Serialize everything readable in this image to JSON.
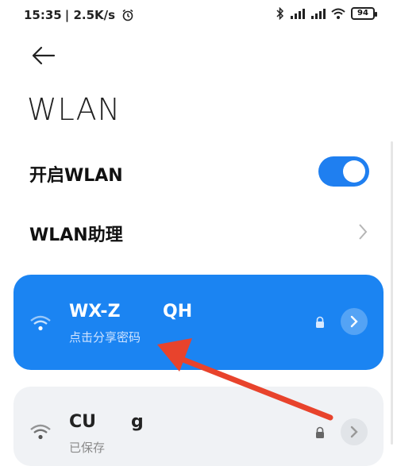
{
  "status": {
    "time": "15:35",
    "speed": "| 2.5K/s",
    "battery": "94"
  },
  "page": {
    "title": "WLAN"
  },
  "settings": {
    "enable_label": "开启WLAN",
    "enable_on": true,
    "assistant_label": "WLAN助理"
  },
  "networks": [
    {
      "name_left": "WX-Z",
      "name_right": "QH",
      "subtitle": "点击分享密码",
      "connected": true
    },
    {
      "name_left": "CU",
      "name_right": "g",
      "subtitle": "已保存",
      "connected": false
    }
  ],
  "colors": {
    "accent": "#1f7ff0",
    "card_active": "#1b84f2",
    "card_saved": "#f0f2f5",
    "annotation": "#e8432c"
  },
  "icons": [
    "back-arrow-icon",
    "alarm-icon",
    "bluetooth-icon",
    "signal-icon",
    "wifi-status-icon",
    "battery-icon",
    "chevron-right-icon",
    "wifi-icon",
    "lock-icon"
  ]
}
